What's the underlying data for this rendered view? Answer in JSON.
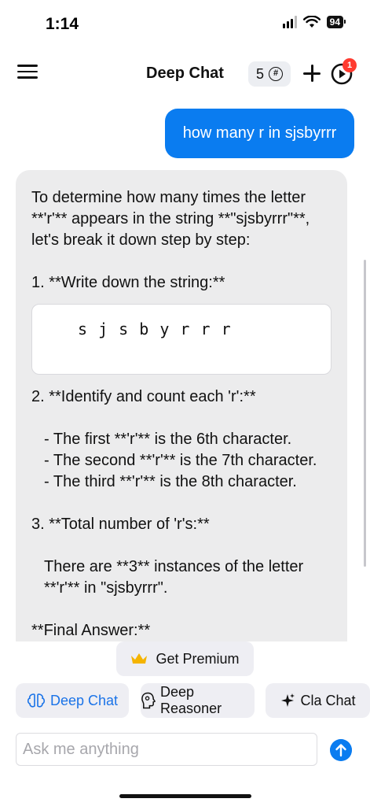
{
  "status_bar": {
    "time": "1:14",
    "battery": "94"
  },
  "header": {
    "title": "Deep Chat",
    "credits": "5",
    "credits_icon_glyph": "#",
    "notification_count": "1",
    "icons": [
      "menu-icon",
      "hash-icon",
      "plus-icon",
      "play-icon"
    ]
  },
  "chat": {
    "user_message": "how many r in sjsbyrrr",
    "assistant": {
      "intro": "To determine how many times the letter **'r'** appears in the string **\"sjsbyrrr\"**, let's break it down step by step:",
      "step1": "1. **Write down the string:**",
      "code": "s j s b y r r r",
      "step2": "2. **Identify and count each 'r':**",
      "bullet1": "- The first **'r'** is the 6th character.",
      "bullet2": "- The second **'r'** is the 7th character.",
      "bullet3": "- The third **'r'** is the 8th character.",
      "step3": "3. **Total number of 'r's:**",
      "total": "There are **3** instances of the letter **'r'** in \"sjsbyrrr\".",
      "final_partial": "**Final Answer:**"
    }
  },
  "controls": {
    "premium_label": "Get Premium",
    "modes": [
      {
        "label": "Deep Chat",
        "icon": "brain-icon",
        "active": true
      },
      {
        "label": "Deep Reasoner",
        "icon": "head-icon",
        "active": false
      },
      {
        "label": "Cla Chat",
        "icon": "sparkle-icon",
        "active": false
      }
    ],
    "input_placeholder": "Ask me anything"
  },
  "colors": {
    "accent": "#0a7cf0",
    "bubble_gray": "#ececed",
    "badge_red": "#ff3b30",
    "crown": "#f5b400"
  }
}
